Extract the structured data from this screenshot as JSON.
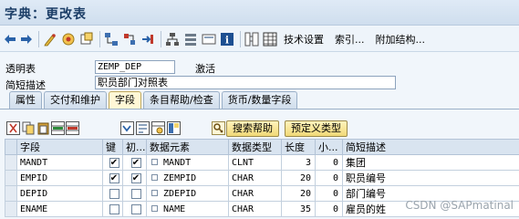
{
  "window": {
    "title": "字典：更改表"
  },
  "toolbar": {
    "icons": [
      "back-arrow-icon",
      "forward-arrow-icon",
      "display-change-icon",
      "activate-icon",
      "other-object-icon",
      "where-used-icon",
      "object-list-icon",
      "navigate-icon",
      "hierarchy-icon",
      "inactive-icon",
      "display-icon",
      "info-icon",
      "indexes-icon",
      "table-grid-icon"
    ],
    "technical_settings_label": "技术设置",
    "index_label": "索引...",
    "append_structure_label": "附加结构..."
  },
  "form": {
    "transparent_table_label": "透明表",
    "table_name": "ZEMP_DEP",
    "status": "激活",
    "short_desc_label": "简短描述",
    "short_desc": "职员部门对照表"
  },
  "tabs": [
    "属性",
    "交付和维护",
    "字段",
    "条目帮助/检查",
    "货币/数量字段"
  ],
  "active_tab": "字段",
  "subtoolbar": {
    "search_help_label": "搜索帮助",
    "predefined_type_label": "预定义类型"
  },
  "table": {
    "headers": [
      "字段",
      "键",
      "初...",
      "数据元素",
      "数据类型",
      "长度",
      "小...",
      "简短描述"
    ],
    "rows": [
      {
        "field": "MANDT",
        "key": true,
        "init": true,
        "data_element": "MANDT",
        "data_type": "CLNT",
        "length": "3",
        "decimals": "0",
        "desc": "集团"
      },
      {
        "field": "EMPID",
        "key": true,
        "init": true,
        "data_element": "ZEMPID",
        "data_type": "CHAR",
        "length": "20",
        "decimals": "0",
        "desc": "职员编号"
      },
      {
        "field": "DEPID",
        "key": false,
        "init": false,
        "data_element": "ZDEPID",
        "data_type": "CHAR",
        "length": "20",
        "decimals": "0",
        "desc": "部门编号"
      },
      {
        "field": "ENAME",
        "key": false,
        "init": false,
        "data_element": "NAME",
        "data_type": "CHAR",
        "length": "35",
        "decimals": "0",
        "desc": "雇员的姓"
      }
    ]
  },
  "watermark": "CSDN @SAPmatinal"
}
